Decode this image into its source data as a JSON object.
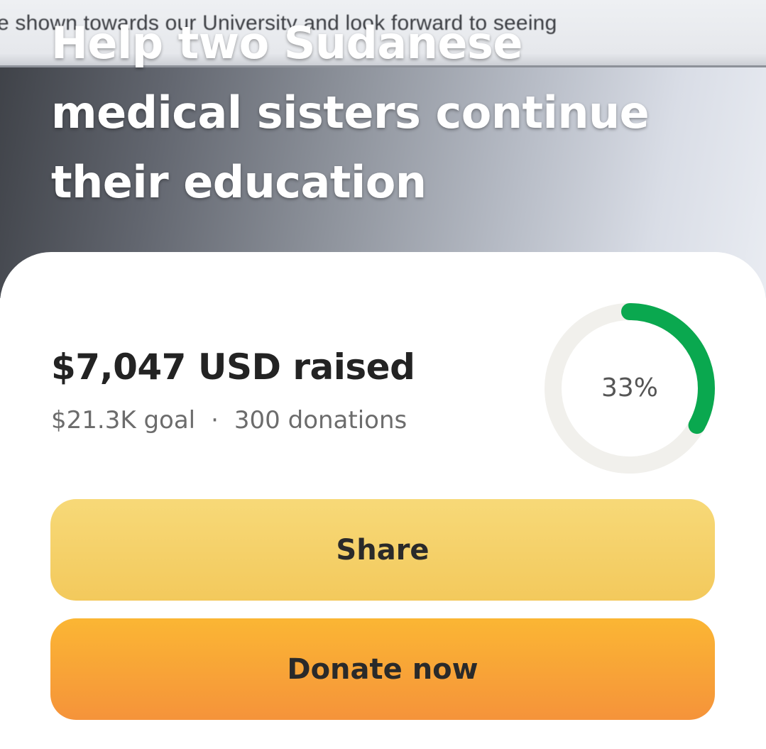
{
  "hero": {
    "background_text": "e shown towards our University and look forward to seeing",
    "title": "Help two Sudanese medical sisters continue their education"
  },
  "fundraiser": {
    "raised": "$7,047 USD raised",
    "goal": "$21.3K goal",
    "separator": "·",
    "donations": "300 donations",
    "progress_percent": 33,
    "progress_label": "33%"
  },
  "buttons": {
    "share": "Share",
    "donate": "Donate now"
  },
  "colors": {
    "progress_fill": "#0aa84f",
    "progress_track": "#f1f0ec",
    "share_button": "#f5d26c",
    "donate_button": "#f7a236",
    "text_primary": "#232323",
    "text_secondary": "#6c6c6c"
  }
}
